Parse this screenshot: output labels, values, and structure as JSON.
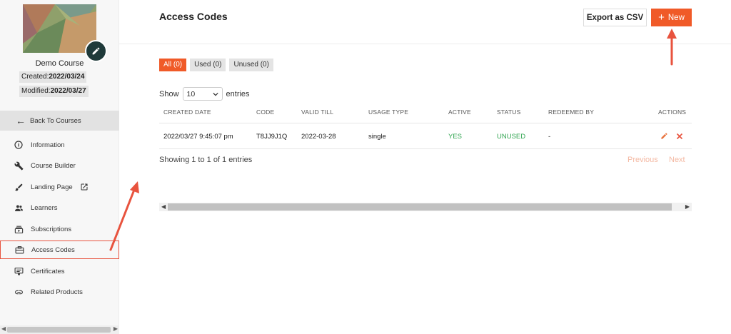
{
  "sidebar": {
    "course_name": "Demo Course",
    "created_label": "Created:",
    "created_date": "2022/03/24",
    "modified_label": "Modified:",
    "modified_date": "2022/03/27",
    "back_label": "Back To Courses",
    "items": [
      {
        "label": "Information",
        "icon": "info-icon"
      },
      {
        "label": "Course Builder",
        "icon": "wrench-icon"
      },
      {
        "label": "Landing Page",
        "icon": "brush-icon"
      },
      {
        "label": "Learners",
        "icon": "people-icon"
      },
      {
        "label": "Subscriptions",
        "icon": "subscriptions-icon"
      },
      {
        "label": "Access Codes",
        "icon": "ticket-icon",
        "active": true
      },
      {
        "label": "Certificates",
        "icon": "certificate-icon"
      },
      {
        "label": "Related Products",
        "icon": "link-icon"
      }
    ]
  },
  "header": {
    "title": "Access Codes",
    "export_label": "Export as CSV",
    "new_label": "New"
  },
  "filters": [
    {
      "label": "All (0)",
      "selected": true
    },
    {
      "label": "Used (0)",
      "selected": false
    },
    {
      "label": "Unused (0)",
      "selected": false
    }
  ],
  "table": {
    "show_label": "Show",
    "entries_value": "10",
    "entries_label": "entries",
    "columns": [
      "CREATED DATE",
      "CODE",
      "VALID TILL",
      "USAGE TYPE",
      "ACTIVE",
      "STATUS",
      "REDEEMED BY",
      "ACTIONS"
    ],
    "rows": [
      {
        "created_date": "2022/03/27 9:45:07 pm",
        "code": "T8JJ9J1Q",
        "valid_till": "2022-03-28",
        "usage_type": "single",
        "active": "YES",
        "status": "UNUSED",
        "redeemed_by": "-"
      }
    ],
    "info": "Showing 1 to 1 of 1 entries",
    "previous_label": "Previous",
    "next_label": "Next"
  },
  "colors": {
    "accent": "#f05a28",
    "annotation": "#e8533e",
    "success": "#2fa44f"
  }
}
